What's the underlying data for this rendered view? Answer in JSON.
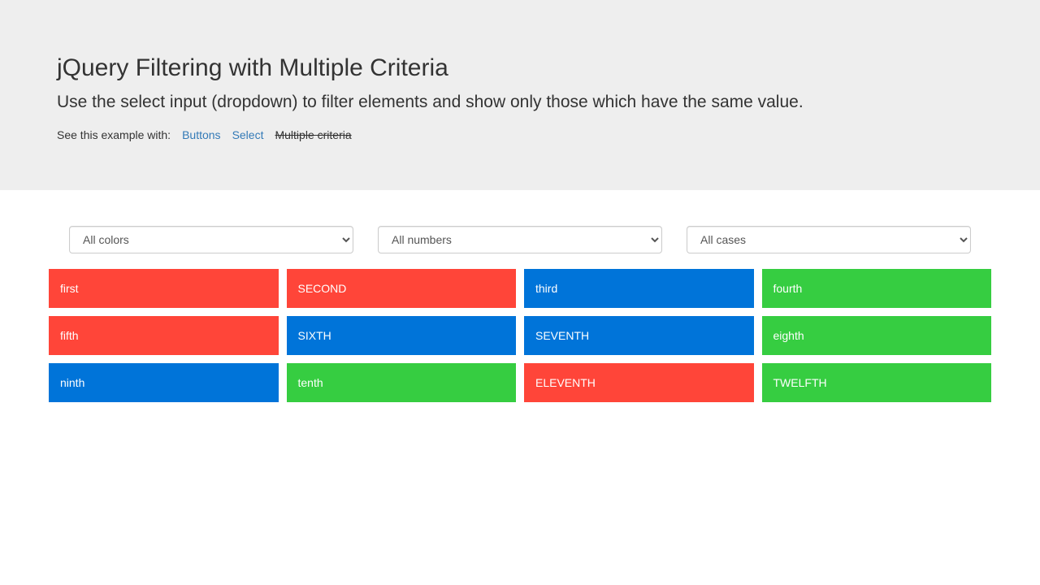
{
  "header": {
    "title": "jQuery Filtering with Multiple Criteria",
    "lead": "Use the select input (dropdown) to filter elements and show only those which have the same value.",
    "examples_label": "See this example with:",
    "links": {
      "buttons": "Buttons",
      "select": "Select",
      "multiple": "Multiple criteria"
    }
  },
  "filters": {
    "color": "All colors",
    "number": "All numbers",
    "case": "All cases"
  },
  "colors": {
    "red": "#ff4539",
    "blue": "#0074d9",
    "green": "#36cd41",
    "link": "#337ab7",
    "jumbotron_bg": "#eeeeee"
  },
  "boxes": [
    {
      "label": "first",
      "color": "red"
    },
    {
      "label": "SECOND",
      "color": "red"
    },
    {
      "label": "third",
      "color": "blue"
    },
    {
      "label": "fourth",
      "color": "green"
    },
    {
      "label": "fifth",
      "color": "red"
    },
    {
      "label": "SIXTH",
      "color": "blue"
    },
    {
      "label": "SEVENTH",
      "color": "blue"
    },
    {
      "label": "eighth",
      "color": "green"
    },
    {
      "label": "ninth",
      "color": "blue"
    },
    {
      "label": "tenth",
      "color": "green"
    },
    {
      "label": "ELEVENTH",
      "color": "red"
    },
    {
      "label": "TWELFTH",
      "color": "green"
    }
  ]
}
